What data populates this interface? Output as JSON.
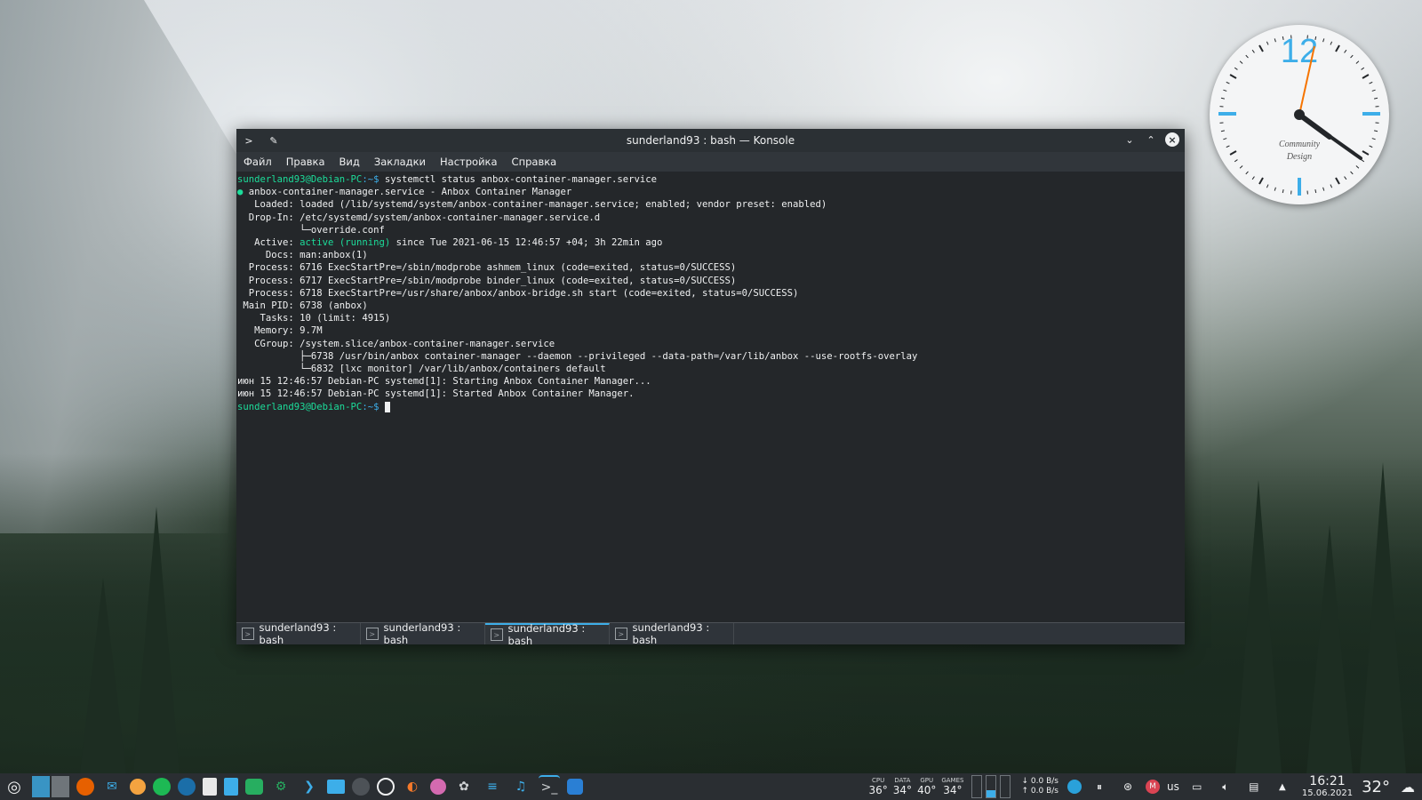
{
  "window": {
    "title": "sunderland93 : bash — Konsole",
    "menu": [
      "Файл",
      "Правка",
      "Вид",
      "Закладки",
      "Настройка",
      "Справка"
    ]
  },
  "terminal": {
    "prompt_user": "sunderland93@Debian-PC",
    "prompt_path": ":~$",
    "command": " systemctl status anbox-container-manager.service",
    "lines": [
      " anbox-container-manager.service - Anbox Container Manager",
      "   Loaded: loaded (/lib/systemd/system/anbox-container-manager.service; enabled; vendor preset: enabled)",
      "  Drop-In: /etc/systemd/system/anbox-container-manager.service.d",
      "           └─override.conf",
      "   Active: ",
      "     Docs: man:anbox(1)",
      "  Process: 6716 ExecStartPre=/sbin/modprobe ashmem_linux (code=exited, status=0/SUCCESS)",
      "  Process: 6717 ExecStartPre=/sbin/modprobe binder_linux (code=exited, status=0/SUCCESS)",
      "  Process: 6718 ExecStartPre=/usr/share/anbox/anbox-bridge.sh start (code=exited, status=0/SUCCESS)",
      " Main PID: 6738 (anbox)",
      "    Tasks: 10 (limit: 4915)",
      "   Memory: 9.7M",
      "   CGroup: /system.slice/anbox-container-manager.service",
      "           ├─6738 /usr/bin/anbox container-manager --daemon --privileged --data-path=/var/lib/anbox --use-rootfs-overlay",
      "           └─6832 [lxc monitor] /var/lib/anbox/containers default",
      "",
      "июн 15 12:46:57 Debian-PC systemd[1]: Starting Anbox Container Manager...",
      "июн 15 12:46:57 Debian-PC systemd[1]: Started Anbox Container Manager."
    ],
    "active_state": "active (running)",
    "active_rest": " since Tue 2021-06-15 12:46:57 +04; 3h 22min ago"
  },
  "tabs": [
    {
      "label": "sunderland93 : bash"
    },
    {
      "label": "sunderland93 : bash"
    },
    {
      "label": "sunderland93 : bash"
    },
    {
      "label": "sunderland93 : bash"
    }
  ],
  "clock_widget": {
    "numeral": "12",
    "brand_line1": "Community",
    "brand_line2": "Design",
    "accent_color": "#3daee9",
    "second_hand_color": "#f67400"
  },
  "taskbar": {
    "apps": [
      "firefox-icon",
      "mail-icon",
      "ubuntu-icon",
      "spotify-icon",
      "steam-icon",
      "text-editor-icon",
      "document-icon",
      "gnumeric-icon",
      "settings-icon",
      "vscode-icon",
      "files-icon",
      "terminal-icon",
      "obs-icon",
      "blender-icon",
      "krita-icon",
      "gimp-icon",
      "mixer-icon",
      "headphones-icon",
      "konsole-icon",
      "libreoffice-icon"
    ],
    "sensors": [
      {
        "label": "CPU",
        "value": "36°"
      },
      {
        "label": "DATA",
        "value": "34°"
      },
      {
        "label": "GPU",
        "value": "40°"
      },
      {
        "label": "GAMES",
        "value": "34°"
      }
    ],
    "net_down": "0.0 B/s",
    "net_up": "0.0 B/s",
    "keyboard_layout": "us",
    "time": "16:21",
    "date": "15.06.2021",
    "weather_temp": "32°"
  }
}
